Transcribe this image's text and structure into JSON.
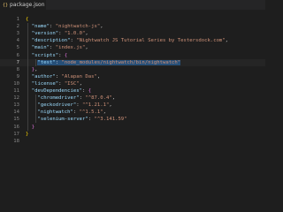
{
  "tab": {
    "icon": "{}",
    "filename": "package.json",
    "close": "×"
  },
  "lines": [
    {
      "n": "1",
      "parts": [
        {
          "t": "{",
          "c": "b"
        }
      ]
    },
    {
      "n": "2",
      "parts": [
        {
          "t": "  "
        },
        {
          "t": "\"name\"",
          "c": "k"
        },
        {
          "t": ": "
        },
        {
          "t": "\"nightwatch-js\"",
          "c": "s"
        },
        {
          "t": ","
        }
      ]
    },
    {
      "n": "3",
      "parts": [
        {
          "t": "  "
        },
        {
          "t": "\"version\"",
          "c": "k"
        },
        {
          "t": ": "
        },
        {
          "t": "\"1.0.0\"",
          "c": "s"
        },
        {
          "t": ","
        }
      ]
    },
    {
      "n": "4",
      "parts": [
        {
          "t": "  "
        },
        {
          "t": "\"description\"",
          "c": "k"
        },
        {
          "t": ": "
        },
        {
          "t": "\"Nightwatch JS Tutorial Series by Testersdock.com\"",
          "c": "s"
        },
        {
          "t": ","
        }
      ]
    },
    {
      "n": "5",
      "parts": [
        {
          "t": "  "
        },
        {
          "t": "\"main\"",
          "c": "k"
        },
        {
          "t": ": "
        },
        {
          "t": "\"index.js\"",
          "c": "s"
        },
        {
          "t": ","
        }
      ]
    },
    {
      "n": "6",
      "parts": [
        {
          "t": "  "
        },
        {
          "t": "\"scripts\"",
          "c": "k"
        },
        {
          "t": ": "
        },
        {
          "t": "{",
          "c": "b2"
        }
      ]
    },
    {
      "n": "7",
      "active": true,
      "parts": [
        {
          "t": "    "
        },
        {
          "t": "\"test\"",
          "c": "k",
          "hl": true
        },
        {
          "t": ": ",
          "hl": true
        },
        {
          "t": "\"node_modules/nightwatch/bin/nightwatch\"",
          "c": "s",
          "hl": true
        }
      ]
    },
    {
      "n": "8",
      "parts": [
        {
          "t": "  "
        },
        {
          "t": "}",
          "c": "b2"
        },
        {
          "t": ","
        }
      ]
    },
    {
      "n": "9",
      "parts": [
        {
          "t": "  "
        },
        {
          "t": "\"author\"",
          "c": "k"
        },
        {
          "t": ": "
        },
        {
          "t": "\"Alapan Das\"",
          "c": "s"
        },
        {
          "t": ","
        }
      ]
    },
    {
      "n": "10",
      "parts": [
        {
          "t": "  "
        },
        {
          "t": "\"license\"",
          "c": "k"
        },
        {
          "t": ": "
        },
        {
          "t": "\"ISC\"",
          "c": "s"
        },
        {
          "t": ","
        }
      ]
    },
    {
      "n": "11",
      "parts": [
        {
          "t": "  "
        },
        {
          "t": "\"devDependencies\"",
          "c": "k"
        },
        {
          "t": ": "
        },
        {
          "t": "{",
          "c": "b2"
        }
      ]
    },
    {
      "n": "12",
      "parts": [
        {
          "t": "    "
        },
        {
          "t": "\"chromedriver\"",
          "c": "k"
        },
        {
          "t": ": "
        },
        {
          "t": "\"^87.0.4\"",
          "c": "s"
        },
        {
          "t": ","
        }
      ]
    },
    {
      "n": "13",
      "parts": [
        {
          "t": "    "
        },
        {
          "t": "\"geckodriver\"",
          "c": "k"
        },
        {
          "t": ": "
        },
        {
          "t": "\"^1.21.1\"",
          "c": "s"
        },
        {
          "t": ","
        }
      ]
    },
    {
      "n": "14",
      "parts": [
        {
          "t": "    "
        },
        {
          "t": "\"nightwatch\"",
          "c": "k"
        },
        {
          "t": ": "
        },
        {
          "t": "\"^1.5.1\"",
          "c": "s"
        },
        {
          "t": ","
        }
      ]
    },
    {
      "n": "15",
      "parts": [
        {
          "t": "    "
        },
        {
          "t": "\"selenium-server\"",
          "c": "k"
        },
        {
          "t": ": "
        },
        {
          "t": "\"^3.141.59\"",
          "c": "s"
        }
      ]
    },
    {
      "n": "16",
      "parts": [
        {
          "t": "  "
        },
        {
          "t": "}",
          "c": "b2"
        }
      ]
    },
    {
      "n": "17",
      "parts": [
        {
          "t": "}",
          "c": "b"
        }
      ]
    },
    {
      "n": "18",
      "parts": []
    }
  ],
  "colors": {
    "background": "#1e1e1e",
    "key": "#9cdcfe",
    "string": "#ce9178",
    "selection": "#264f78"
  }
}
